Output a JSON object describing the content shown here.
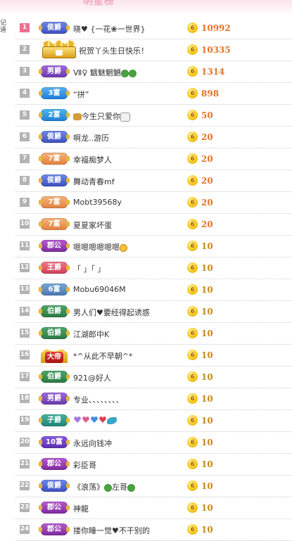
{
  "header": {
    "title": "明星榜",
    "side_text": "记道"
  },
  "rows": [
    {
      "rank": "1",
      "badge": "侯爵",
      "badge_style": "b-hou",
      "name": "晓♥ {一花❀一世界}",
      "score": "10992",
      "score_style": "hi"
    },
    {
      "rank": "2",
      "badge": "",
      "badge_style": "crown",
      "name": "祝贺丫头生日快乐！",
      "score": "10335",
      "score_style": "hi"
    },
    {
      "rank": "3",
      "badge": "男爵",
      "badge_style": "b-nan",
      "name": "Ⅶ♀ 魑魅魍魉",
      "score": "1314",
      "score_style": "hi"
    },
    {
      "rank": "4",
      "badge": "3富",
      "badge_style": "b-fu3",
      "name": "“拼”",
      "score": "898",
      "score_style": "hi"
    },
    {
      "rank": "5",
      "badge": "2富",
      "badge_style": "b-fu2",
      "name": "今生只爱你",
      "score": "50",
      "score_style": "hi"
    },
    {
      "rank": "6",
      "badge": "侯爵",
      "badge_style": "b-hou",
      "name": "啊龙..游历",
      "score": "20",
      "score_style": "hi"
    },
    {
      "rank": "7",
      "badge": "7富",
      "badge_style": "b-fu7",
      "name": "幸福痴梦人",
      "score": "20",
      "score_style": "hi"
    },
    {
      "rank": "8",
      "badge": "侯爵",
      "badge_style": "b-hou",
      "name": "舞动青春mf",
      "score": "20",
      "score_style": "hi"
    },
    {
      "rank": "9",
      "badge": "7富",
      "badge_style": "b-fu7",
      "name": "Mobt39568y",
      "score": "20",
      "score_style": "hi"
    },
    {
      "rank": "10",
      "badge": "7富",
      "badge_style": "b-fu7",
      "name": "夏夏家坏蛋",
      "score": "20",
      "score_style": "hi"
    },
    {
      "rank": "11",
      "badge": "郡公",
      "badge_style": "b-jun",
      "name": "嗯嗯嗯嗯嗯嗯",
      "score": "10",
      "score_style": "lo"
    },
    {
      "rank": "12",
      "badge": "王爵",
      "badge_style": "b-wang",
      "name": "「 」「 」",
      "score": "10",
      "score_style": "lo"
    },
    {
      "rank": "13",
      "badge": "6富",
      "badge_style": "b-fu6",
      "name": "Mobu69046M",
      "score": "10",
      "score_style": "lo"
    },
    {
      "rank": "14",
      "badge": "伯爵",
      "badge_style": "b-bo",
      "name": "男人们♥要经得起诱惑",
      "score": "10",
      "score_style": "lo"
    },
    {
      "rank": "15",
      "badge": "伯爵",
      "badge_style": "b-bo",
      "name": "江湖郎中K",
      "score": "10",
      "score_style": "lo"
    },
    {
      "rank": "16",
      "badge": "大帝",
      "badge_style": "emperor",
      "name": "*^从此不早朝^*",
      "score": "10",
      "score_style": "lo"
    },
    {
      "rank": "17",
      "badge": "伯爵",
      "badge_style": "b-bo",
      "name": "921@好人",
      "score": "10",
      "score_style": "lo"
    },
    {
      "rank": "18",
      "badge": "男爵",
      "badge_style": "b-nan",
      "name": "专业、、、、、、、、",
      "score": "10",
      "score_style": "lo"
    },
    {
      "rank": "19",
      "badge": "子爵",
      "badge_style": "b-zi",
      "name": "",
      "score": "10",
      "score_style": "lo"
    },
    {
      "rank": "20",
      "badge": "10富",
      "badge_style": "b-fu10",
      "name": "永远向钱冲",
      "score": "10",
      "score_style": "lo"
    },
    {
      "rank": "21",
      "badge": "郡公",
      "badge_style": "b-jun",
      "name": "彩臣哥",
      "score": "10",
      "score_style": "lo"
    },
    {
      "rank": "22",
      "badge": "侯爵",
      "badge_style": "b-hou",
      "name": "《浪荡》",
      "name_suffix": "左哥",
      "score": "10",
      "score_style": "lo"
    },
    {
      "rank": "23",
      "badge": "郡公",
      "badge_style": "b-jun",
      "name": "神龍",
      "score": "10",
      "score_style": "lo"
    },
    {
      "rank": "24",
      "badge": "郡公",
      "badge_style": "b-jun",
      "name": "搂你睡一觉♥不干别的",
      "score": "10",
      "score_style": "lo"
    }
  ],
  "coin_label": "6",
  "colors": {
    "score_high": "#e5732a",
    "score_low": "#c58a15",
    "rank_first": "#ee6f90",
    "rank_default": "#b3b3b3"
  }
}
